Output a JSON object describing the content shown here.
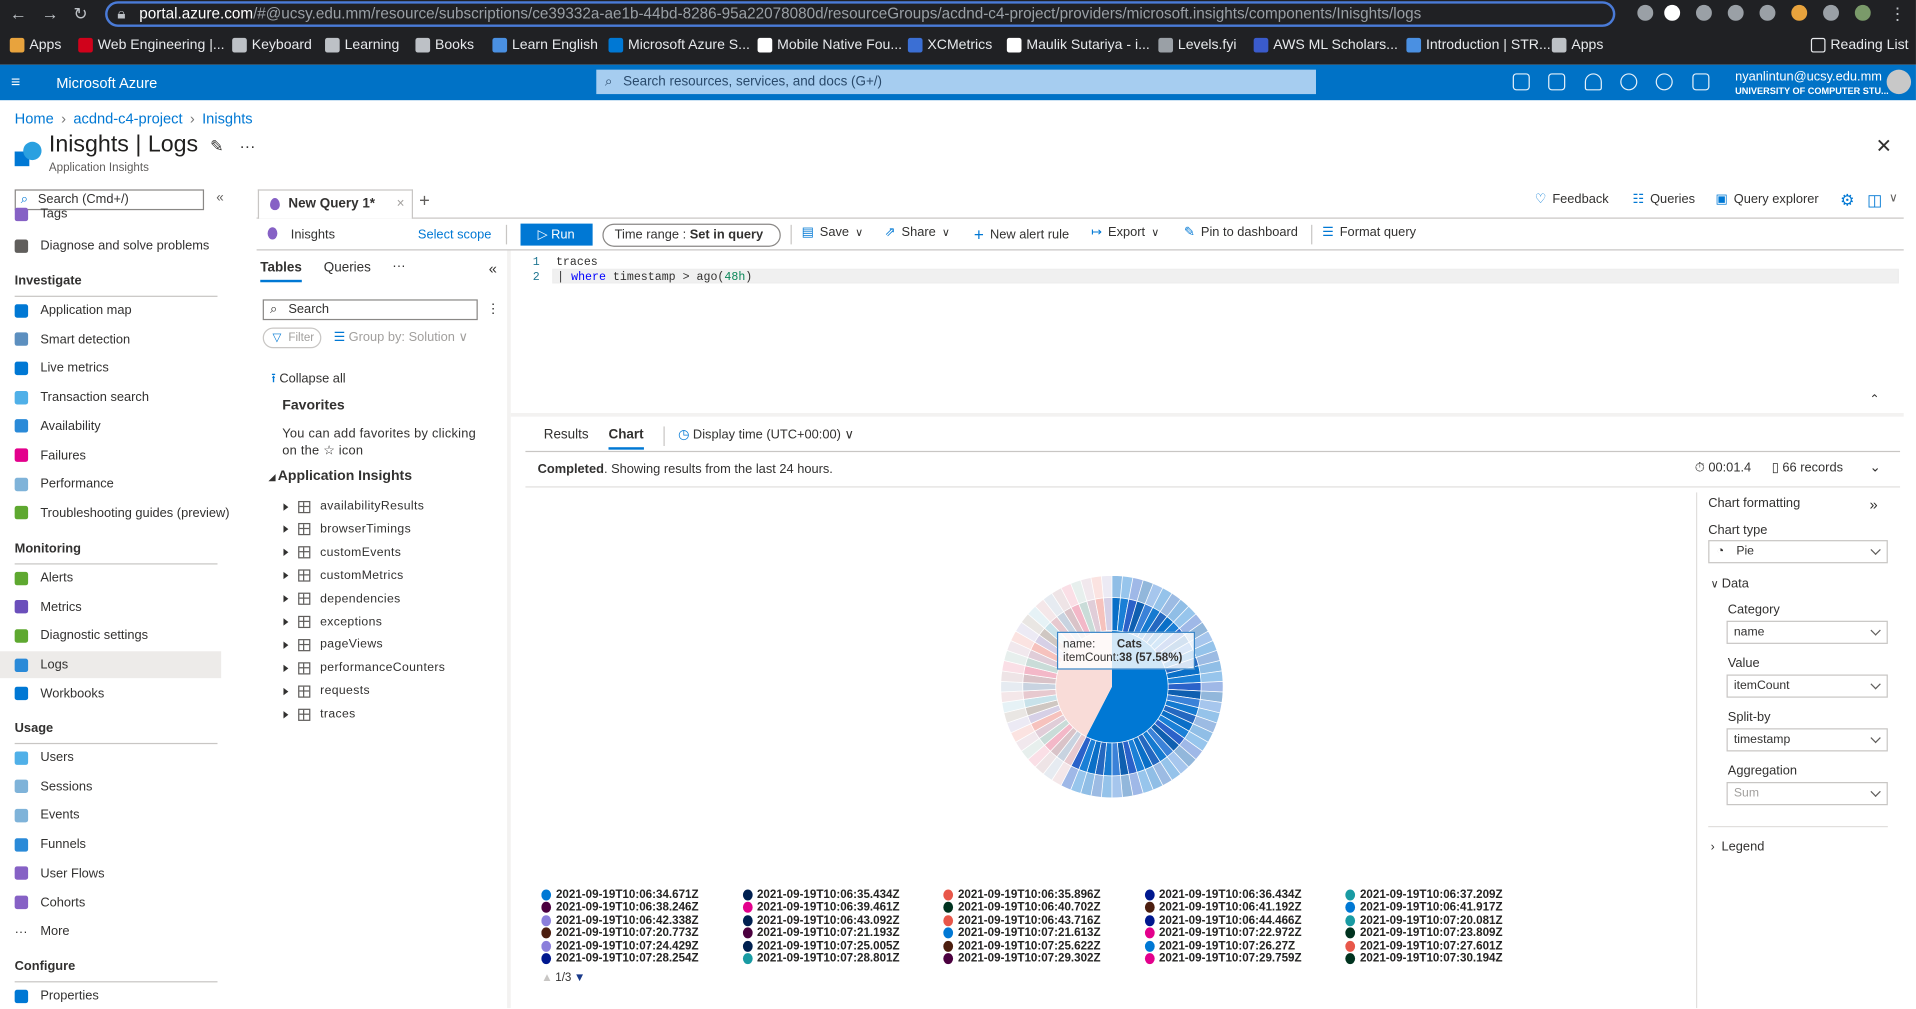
{
  "browser": {
    "url_host": "portal.azure.com",
    "url_rest": "/#@ucsy.edu.mm/resource/subscriptions/ce39332a-ae1b-44bd-8286-95a22078080d/resourceGroups/acdnd-c4-project/providers/microsoft.insights/components/Inisghts/logs",
    "bookmarks": [
      {
        "label": "Apps",
        "color": "#e8a33d"
      },
      {
        "label": "Web Engineering |...",
        "color": "#d0021b"
      },
      {
        "label": "Keyboard",
        "color": "#bdc1c6"
      },
      {
        "label": "Learning",
        "color": "#bdc1c6"
      },
      {
        "label": "Books",
        "color": "#bdc1c6"
      },
      {
        "label": "Learn English",
        "color": "#4a90e2"
      },
      {
        "label": "Microsoft Azure S...",
        "color": "#0078d4"
      },
      {
        "label": "Mobile Native Fou...",
        "color": "#ffffff"
      },
      {
        "label": "XCMetrics",
        "color": "#3b6fd4"
      },
      {
        "label": "Maulik Sutariya - i...",
        "color": "#ffffff"
      },
      {
        "label": "Levels.fyi",
        "color": "#9aa0a6"
      },
      {
        "label": "AWS ML Scholars...",
        "color": "#3a5bcc"
      },
      {
        "label": "Introduction | STR...",
        "color": "#4a90e2"
      },
      {
        "label": "Apps",
        "color": "#bdc1c6"
      }
    ],
    "reading_list": "Reading List"
  },
  "azure": {
    "brand": "Microsoft Azure",
    "search_placeholder": "Search resources, services, and docs (G+/)",
    "user_email": "nyanlintun@ucsy.edu.mm",
    "user_org": "UNIVERSITY OF COMPUTER STU...",
    "accent": "#0072c6"
  },
  "breadcrumb": [
    "Home",
    "acdnd-c4-project",
    "Inisghts"
  ],
  "page": {
    "title": "Inisghts | Logs",
    "subtitle": "Application Insights"
  },
  "sidebar": {
    "search_placeholder": "Search (Cmd+/)",
    "top_items": [
      {
        "label": "Tags",
        "color": "#8661c5"
      },
      {
        "label": "Diagnose and solve problems",
        "color": "#605e5c"
      }
    ],
    "sections": [
      {
        "title": "Investigate",
        "items": [
          {
            "label": "Application map",
            "color": "#0078d4"
          },
          {
            "label": "Smart detection",
            "color": "#5c8fbf"
          },
          {
            "label": "Live metrics",
            "color": "#0078d4"
          },
          {
            "label": "Transaction search",
            "color": "#50b0e8"
          },
          {
            "label": "Availability",
            "color": "#2a8ad8"
          },
          {
            "label": "Failures",
            "color": "#e3008c"
          },
          {
            "label": "Performance",
            "color": "#7fb3d9"
          },
          {
            "label": "Troubleshooting guides (preview)",
            "color": "#5ea830"
          }
        ]
      },
      {
        "title": "Monitoring",
        "items": [
          {
            "label": "Alerts",
            "color": "#5ea830"
          },
          {
            "label": "Metrics",
            "color": "#6b4fbb"
          },
          {
            "label": "Diagnostic settings",
            "color": "#5ea830"
          },
          {
            "label": "Logs",
            "color": "#2a8ad8",
            "selected": true
          },
          {
            "label": "Workbooks",
            "color": "#0078d4"
          }
        ]
      },
      {
        "title": "Usage",
        "items": [
          {
            "label": "Users",
            "color": "#50b0e8"
          },
          {
            "label": "Sessions",
            "color": "#7fb3d9"
          },
          {
            "label": "Events",
            "color": "#7fb3d9"
          },
          {
            "label": "Funnels",
            "color": "#2a8ad8"
          },
          {
            "label": "User Flows",
            "color": "#8661c5"
          },
          {
            "label": "Cohorts",
            "color": "#8661c5"
          },
          {
            "label": "More",
            "color": "transparent"
          }
        ]
      },
      {
        "title": "Configure",
        "items": [
          {
            "label": "Properties",
            "color": "#0078d4"
          }
        ]
      }
    ]
  },
  "query_tab": {
    "label": "New Query 1*",
    "add": "+"
  },
  "top_actions": [
    "Feedback",
    "Queries",
    "Query explorer"
  ],
  "scope": {
    "name": "Inisghts",
    "select": "Select scope"
  },
  "toolbar": {
    "run": "Run",
    "time_range_label": "Time range :",
    "time_range_value": "Set in query",
    "save": "Save",
    "share": "Share",
    "new_alert": "New alert rule",
    "export": "Export",
    "pin": "Pin to dashboard",
    "format": "Format query"
  },
  "tables_panel": {
    "tabs": [
      "Tables",
      "Queries"
    ],
    "search_placeholder": "Search",
    "filter": "Filter",
    "group_by": "Group by: Solution",
    "collapse_all": "Collapse all",
    "favorites_title": "Favorites",
    "favorites_hint_1": "You can add favorites by clicking",
    "favorites_hint_2": "on the ☆ icon",
    "group": "Application Insights",
    "tables": [
      "availabilityResults",
      "browserTimings",
      "customEvents",
      "customMetrics",
      "dependencies",
      "exceptions",
      "pageViews",
      "performanceCounters",
      "requests",
      "traces"
    ]
  },
  "editor": {
    "lines": [
      {
        "num": "1",
        "text": "traces"
      },
      {
        "num": "2",
        "kw": "where",
        "text": " timestamp > ago(",
        "arg": "48h",
        "end": ")"
      }
    ]
  },
  "results": {
    "tabs": [
      "Results",
      "Chart"
    ],
    "active_tab": "Chart",
    "display_time": "Display time (UTC+00:00)",
    "status_bold": "Completed",
    "status_text": ". Showing results from the last 24 hours.",
    "duration": "00:01.4",
    "records": "66 records"
  },
  "chart_formatting": {
    "title": "Chart formatting",
    "chart_type_label": "Chart type",
    "chart_type": "Pie",
    "data_label": "Data",
    "category_label": "Category",
    "category": "name",
    "value_label": "Value",
    "value": "itemCount",
    "split_label": "Split-by",
    "split": "timestamp",
    "aggregation_label": "Aggregation",
    "aggregation": "Sum",
    "legend_label": "Legend"
  },
  "chart_data": {
    "type": "pie",
    "slices": [
      {
        "name": "Cats",
        "value": 38,
        "color": "#0078d4"
      },
      {
        "value": 28,
        "color": "#f9dcd8"
      }
    ],
    "tooltip": {
      "name_label": "name:",
      "name": "Cats",
      "value_label": "itemCount:",
      "value": "38 (57.58%)"
    },
    "legend_page": "1/3",
    "legend": [
      {
        "label": "2021-09-19T10:06:34.671Z",
        "color": "#0078d4"
      },
      {
        "label": "2021-09-19T10:06:35.434Z",
        "color": "#002050"
      },
      {
        "label": "2021-09-19T10:06:35.896Z",
        "color": "#e8574a"
      },
      {
        "label": "2021-09-19T10:06:36.434Z",
        "color": "#00188f"
      },
      {
        "label": "2021-09-19T10:06:37.209Z",
        "color": "#199ba3"
      },
      {
        "label": "2021-09-19T10:06:38.246Z",
        "color": "#4b003f"
      },
      {
        "label": "2021-09-19T10:06:39.461Z",
        "color": "#e3008c"
      },
      {
        "label": "2021-09-19T10:06:40.702Z",
        "color": "#00331f"
      },
      {
        "label": "2021-09-19T10:06:41.192Z",
        "color": "#4c1e0f"
      },
      {
        "label": "2021-09-19T10:06:41.917Z",
        "color": "#0078d4"
      },
      {
        "label": "2021-09-19T10:06:42.338Z",
        "color": "#8b7fdb"
      },
      {
        "label": "2021-09-19T10:06:43.092Z",
        "color": "#002050"
      },
      {
        "label": "2021-09-19T10:06:43.716Z",
        "color": "#e8574a"
      },
      {
        "label": "2021-09-19T10:06:44.466Z",
        "color": "#00188f"
      },
      {
        "label": "2021-09-19T10:07:20.081Z",
        "color": "#199ba3"
      },
      {
        "label": "2021-09-19T10:07:20.773Z",
        "color": "#4c1e0f"
      },
      {
        "label": "2021-09-19T10:07:21.193Z",
        "color": "#4b003f"
      },
      {
        "label": "2021-09-19T10:07:21.613Z",
        "color": "#0078d4"
      },
      {
        "label": "2021-09-19T10:07:22.972Z",
        "color": "#e3008c"
      },
      {
        "label": "2021-09-19T10:07:23.809Z",
        "color": "#00331f"
      },
      {
        "label": "2021-09-19T10:07:24.429Z",
        "color": "#8b7fdb"
      },
      {
        "label": "2021-09-19T10:07:25.005Z",
        "color": "#002050"
      },
      {
        "label": "2021-09-19T10:07:25.622Z",
        "color": "#4c1e0f"
      },
      {
        "label": "2021-09-19T10:07:26.27Z",
        "color": "#0078d4"
      },
      {
        "label": "2021-09-19T10:07:27.601Z",
        "color": "#e8574a"
      },
      {
        "label": "2021-09-19T10:07:28.254Z",
        "color": "#00188f"
      },
      {
        "label": "2021-09-19T10:07:28.801Z",
        "color": "#199ba3"
      },
      {
        "label": "2021-09-19T10:07:29.302Z",
        "color": "#4b003f"
      },
      {
        "label": "2021-09-19T10:07:29.759Z",
        "color": "#e3008c"
      },
      {
        "label": "2021-09-19T10:07:30.194Z",
        "color": "#00331f"
      }
    ]
  }
}
